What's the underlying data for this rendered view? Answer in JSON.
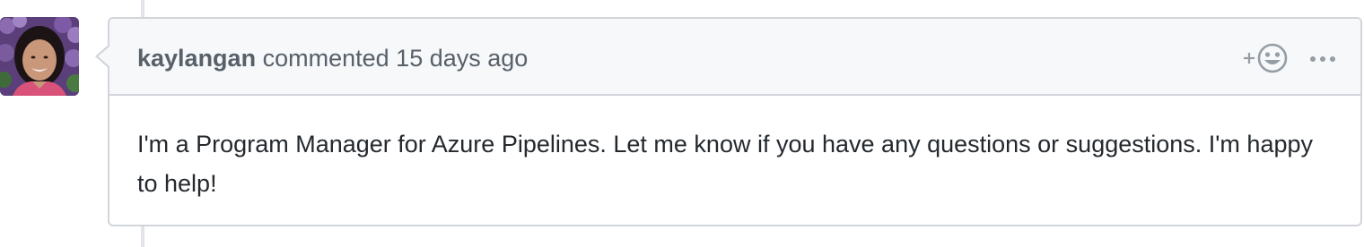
{
  "comment": {
    "author": "kaylangan",
    "action": "commented",
    "timestamp": "15 days ago",
    "body": "I'm a Program Manager for Azure Pipelines. Let me know if you have any questions or suggestions. I'm happy to help!"
  },
  "icons": {
    "add_reaction": "smiley-plus-icon",
    "more": "kebab-horizontal-icon"
  },
  "colors": {
    "header_bg": "#f6f8fa",
    "border": "#d1d5da",
    "text": "#24292e",
    "muted": "#586069",
    "icon": "#959da5"
  }
}
